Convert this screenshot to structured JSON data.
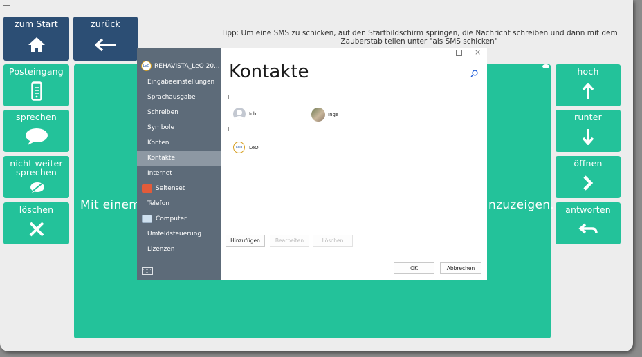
{
  "window_controls": {
    "restore": "◻",
    "close": "×"
  },
  "tip": "Tipp: Um eine SMS zu schicken, auf den Startbildschirm springen, die Nachricht schreiben und dann mit dem Zauberstab teilen unter \"als SMS schicken\"",
  "left_tiles": [
    {
      "label": "zum Start",
      "icon": "home-icon"
    },
    {
      "label": "zurück",
      "icon": "arrow-left-icon"
    },
    {
      "label": "Posteingang",
      "icon": "phone-icon"
    },
    {
      "label": "sprechen",
      "icon": "speech-bubble-icon"
    },
    {
      "label": "nicht weiter sprechen",
      "icon": "stop-speech-icon"
    },
    {
      "label": "löschen",
      "icon": "close-icon"
    }
  ],
  "right_tiles": [
    {
      "label": "hoch",
      "icon": "arrow-up-icon"
    },
    {
      "label": "runter",
      "icon": "arrow-down-icon"
    },
    {
      "label": "öffnen",
      "icon": "chevron-right-icon"
    },
    {
      "label": "antworten",
      "icon": "reply-icon"
    }
  ],
  "panel_text_left": "Mit einem",
  "panel_text_right": "nzuzeigen.",
  "dialog": {
    "app_name": "REHAVISTA_LeO 20...",
    "nav": [
      {
        "label": "Eingabeeinstellungen"
      },
      {
        "label": "Sprachausgabe"
      },
      {
        "label": "Schreiben"
      },
      {
        "label": "Symbole"
      },
      {
        "label": "Konten"
      },
      {
        "label": "Kontakte",
        "selected": true
      },
      {
        "label": "Internet"
      },
      {
        "label": "Seitenset",
        "icon": "seitenset-icon"
      },
      {
        "label": "Telefon"
      },
      {
        "label": "Computer",
        "icon": "computer-icon"
      },
      {
        "label": "Umfeldsteuerung"
      },
      {
        "label": "Lizenzen"
      }
    ],
    "keyboard_icon": "keyboard-icon",
    "title": "Kontakte",
    "groups": [
      {
        "letter": "I",
        "contacts": [
          {
            "name": "Ich",
            "avatar": "generic-avatar-icon"
          },
          {
            "name": "Inge",
            "avatar": "photo-avatar-icon"
          }
        ]
      },
      {
        "letter": "L",
        "contacts": [
          {
            "name": "LeO",
            "avatar": "leo-logo-icon"
          }
        ]
      }
    ],
    "buttons": {
      "add": "Hinzufügen",
      "edit": "Bearbeiten",
      "delete": "Löschen",
      "ok": "OK",
      "cancel": "Abbrechen"
    },
    "logo_text": "LeO"
  },
  "colors": {
    "navy": "#2c4e74",
    "green": "#23c29a",
    "sidebar": "#5d6b79",
    "sidebar_selected": "#8d98a3",
    "accent": "#1d5bd8"
  }
}
